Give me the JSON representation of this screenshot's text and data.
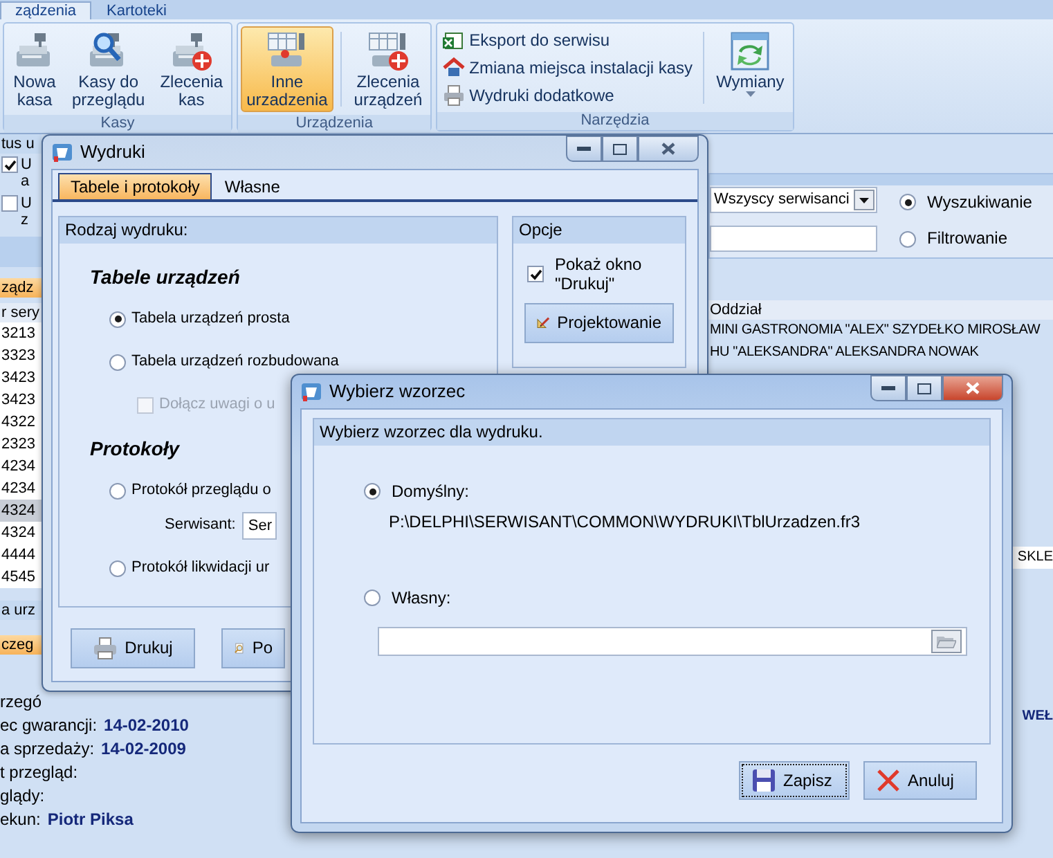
{
  "ribbon": {
    "tabs": [
      {
        "label": "ządzenia",
        "selected": true
      },
      {
        "label": "Kartoteki",
        "selected": false
      }
    ],
    "groups": [
      {
        "label": "Kasy",
        "buttons": [
          {
            "lines": [
              "Nowa",
              "kasa"
            ],
            "selected": false
          },
          {
            "lines": [
              "Kasy do",
              "przeglądu"
            ],
            "selected": false
          },
          {
            "lines": [
              "Zlecenia",
              "kas"
            ],
            "selected": false
          }
        ]
      },
      {
        "label": "Urządzenia",
        "buttons": [
          {
            "lines": [
              "Inne",
              "urzadzenia"
            ],
            "selected": true
          },
          {
            "lines": [
              "Zlecenia",
              "urządzeń"
            ],
            "selected": false
          }
        ]
      },
      {
        "label": "Narzędzia",
        "links": [
          "Eksport do serwisu",
          "Zmiana miejsca instalacji kasy",
          "Wydruki dodatkowe"
        ],
        "buttons": [
          {
            "lines": [
              "Wymiany"
            ],
            "selected": false,
            "dropdown": true
          }
        ]
      }
    ]
  },
  "status_panel": {
    "title": "tus u",
    "options": [
      {
        "lines": [
          "U",
          "a"
        ],
        "checked": true
      },
      {
        "lines": [
          "U",
          "z"
        ],
        "checked": false
      }
    ]
  },
  "device_table": {
    "tab": "ządz",
    "column": "r sery",
    "rows": [
      {
        "value": "3213",
        "selected": false
      },
      {
        "value": "3323",
        "selected": false
      },
      {
        "value": "3423",
        "selected": false
      },
      {
        "value": "3423",
        "selected": false
      },
      {
        "value": "4322",
        "selected": false
      },
      {
        "value": "2323",
        "selected": false
      },
      {
        "value": "4234",
        "selected": false
      },
      {
        "value": "4234",
        "selected": false
      },
      {
        "value": "4324",
        "selected": true
      },
      {
        "value": "4324",
        "selected": false
      },
      {
        "value": "4444",
        "selected": false
      },
      {
        "value": "4545",
        "selected": false
      }
    ]
  },
  "detail_tabs": [
    {
      "label": "a urz",
      "selected": false
    },
    {
      "label": "czeg",
      "selected": true
    }
  ],
  "details": [
    {
      "label": "rzegó"
    },
    {
      "label": "ec gwarancji:",
      "value": "14-02-2010"
    },
    {
      "label": "a sprzedaży:",
      "value": "14-02-2009"
    },
    {
      "label": "t przegląd:"
    },
    {
      "label": "glądy:"
    },
    {
      "label": "ekun:",
      "value": "Piotr Piksa"
    }
  ],
  "filter_panel": {
    "serviceman": "Wszyscy serwisanci",
    "modes": [
      {
        "label": "Wyszukiwanie",
        "selected": true
      },
      {
        "label": "Filtrowanie",
        "selected": false
      }
    ]
  },
  "main_table": {
    "column": "Oddział",
    "rows": [
      "MINI GASTRONOMIA \"ALEX\" SZYDEŁKO MIROSŁAW",
      "HU \"ALEKSANDRA\" ALEKSANDRA NOWAK"
    ],
    "lower_cell": "SKLE"
  },
  "detail_fragment": "WEŁ",
  "print_window": {
    "title": "Wydruki",
    "active": false,
    "tabs": [
      {
        "label": "Tabele i protokoły",
        "selected": true
      },
      {
        "label": "Własne",
        "selected": false
      }
    ],
    "type_box": {
      "title": "Rodzaj wydruku:",
      "sections": [
        {
          "heading": "Tabele urządzeń",
          "items": [
            {
              "kind": "radio",
              "label": "Tabela urządzeń prosta",
              "selected": true
            },
            {
              "kind": "radio",
              "label": "Tabela urządzeń rozbudowana",
              "selected": false
            },
            {
              "kind": "checkbox",
              "label": "Dołącz uwagi o u",
              "checked": false,
              "disabled": true
            }
          ]
        },
        {
          "heading": "Protokoły",
          "items": [
            {
              "kind": "radio",
              "label": "Protokół przeglądu o",
              "selected": false
            },
            {
              "kind": "combo",
              "label": "Serwisant:",
              "value": "Ser"
            },
            {
              "kind": "radio",
              "label": "Protokół likwidacji ur",
              "selected": false
            }
          ]
        }
      ]
    },
    "options_box": {
      "title": "Opcje",
      "show_print": {
        "label": "Pokaż okno \"Drukuj\"",
        "checked": true
      },
      "design_button": "Projektowanie"
    },
    "buttons": [
      "Drukuj",
      "Po"
    ]
  },
  "template_window": {
    "title": "Wybierz wzorzec",
    "active": true,
    "header": "Wybierz wzorzec dla wydruku.",
    "options": [
      {
        "label": "Domyślny:",
        "selected": true,
        "path": "P:\\DELPHI\\SERWISANT\\COMMON\\WYDRUKI\\TblUrzadzen.fr3"
      },
      {
        "label": "Własny:",
        "selected": false
      }
    ],
    "buttons": [
      {
        "label": "Zapisz",
        "focused": true
      },
      {
        "label": "Anuluj",
        "focused": false
      }
    ]
  }
}
